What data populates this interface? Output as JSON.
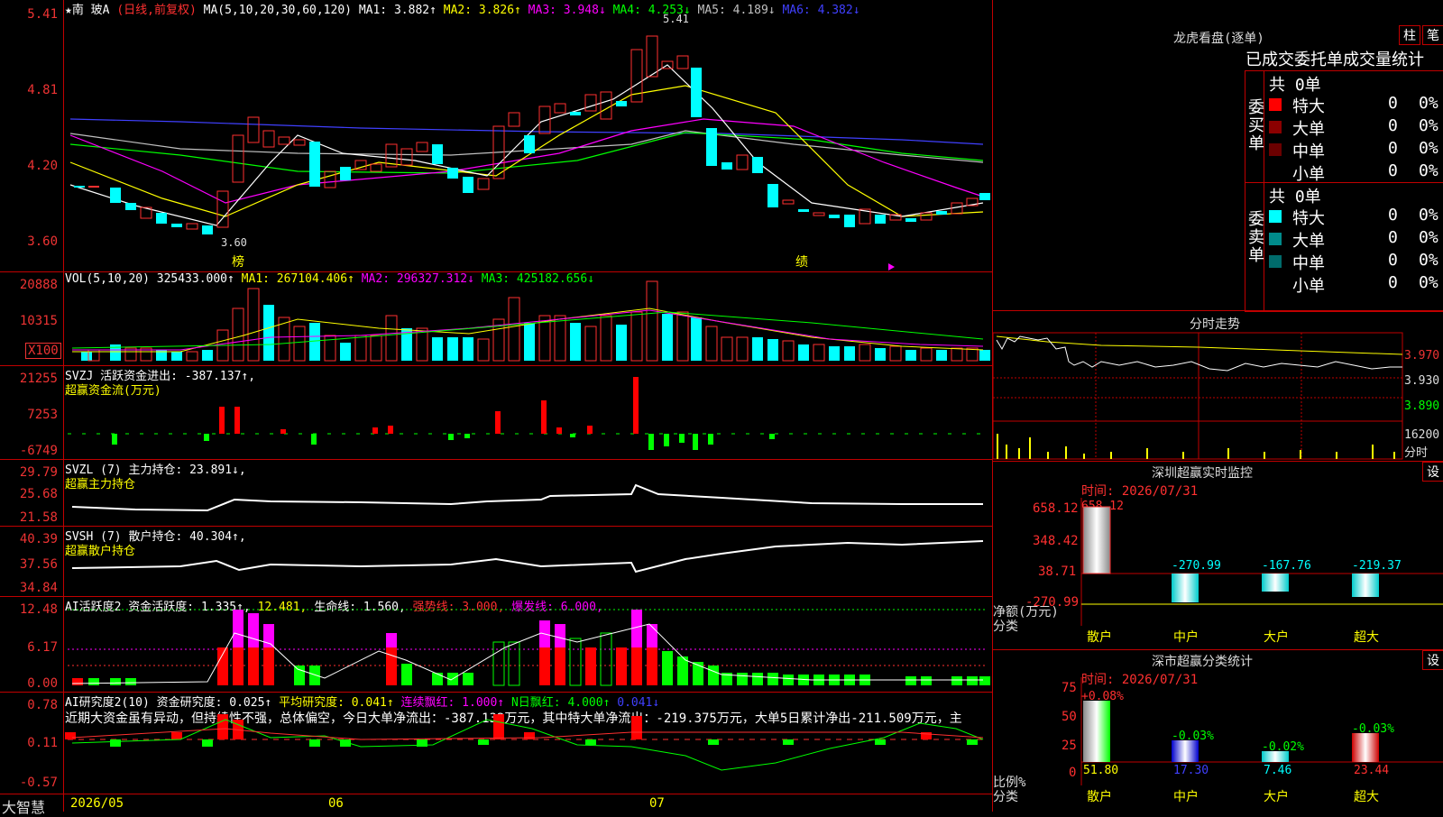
{
  "main": {
    "title": "★南  玻A",
    "period": "(日线,前复权)",
    "ma_header": "MA(5,10,20,30,60,120)",
    "ma_values": [
      {
        "label": "MA1: 3.882↑",
        "color": "#ffffff"
      },
      {
        "label": "MA2: 3.826↑",
        "color": "#ffff00"
      },
      {
        "label": "MA3: 3.948↓",
        "color": "#ff00ff"
      },
      {
        "label": "MA4: 4.253↓",
        "color": "#00ff00"
      },
      {
        "label": "MA5: 4.189↓",
        "color": "#c0c0c0"
      },
      {
        "label": "MA6: 4.382↓",
        "color": "#4040ff"
      }
    ],
    "y_ticks": [
      "5.41",
      "4.81",
      "4.20",
      "3.60"
    ],
    "high_label": "5.41",
    "low_label": "3.60",
    "marker_bang": "榜",
    "marker_ji": "绩"
  },
  "vol": {
    "header": "VOL(5,10,20)  325433.000↑",
    "ma_values": [
      {
        "label": "MA1: 267104.406↑",
        "color": "#ffffff"
      },
      {
        "label": "MA2: 296327.312↓",
        "color": "#ff00ff"
      },
      {
        "label": "MA3: 425182.656↓",
        "color": "#00ff00"
      }
    ],
    "y_ticks": [
      "20888",
      "10315"
    ],
    "unit": "X100"
  },
  "svzj": {
    "header": "SVZJ  活跃资金进出: -387.137↑,",
    "sub": "超赢资金流(万元)",
    "y_ticks": [
      "21255",
      "7253",
      "-6749"
    ]
  },
  "svzl": {
    "header": "SVZL (7) 主力持仓: 23.891↓,",
    "sub": "超赢主力持仓",
    "y_ticks": [
      "29.79",
      "25.68",
      "21.58"
    ]
  },
  "svsh": {
    "header": "SVSH (7) 散户持仓: 40.304↑,",
    "sub": "超赢散户持仓",
    "y_ticks": [
      "40.39",
      "37.56",
      "34.84"
    ]
  },
  "ai1": {
    "header": "AI活跃度2 资金活跃度: 1.335↑,",
    "v2": "12.481,",
    "v3": "生命线: 1.560,",
    "v4": "强势线: 3.000,",
    "v5": "爆发线: 6.000,",
    "y_ticks": [
      "12.48",
      "6.17",
      "0.00"
    ]
  },
  "ai2": {
    "header": "AI研究度2(10) 资金研究度: 0.025↑",
    "v2": "平均研究度: 0.041↑",
    "v3": "连续飘红: 1.000↑",
    "v4": "N日飘红: 4.000↑",
    "v5": "0.041↓",
    "text": "近期大资金虽有异动，但持续性不强，总体偏空，今日大单净流出：-387.132万元，其中特大单净流出：-219.375万元，大单5日累计净出-211.509万元，主",
    "y_ticks": [
      "0.78",
      "0.11",
      "-0.57"
    ]
  },
  "bottom": {
    "brand": "大智慧",
    "dates": [
      "2026/05",
      "06",
      "07"
    ]
  },
  "right": {
    "lhkp_title": "龙虎看盘(逐单)",
    "btn_zhu": "柱",
    "btn_bi": "笔",
    "stats_title": "已成交委托单成交量统计",
    "buy_label": "委买单",
    "sell_label": "委卖单",
    "total_label": "共 0单",
    "rows": [
      {
        "name": "特大",
        "val": "0",
        "pct": "0%"
      },
      {
        "name": "大单",
        "val": "0",
        "pct": "0%"
      },
      {
        "name": "中单",
        "val": "0",
        "pct": "0%"
      },
      {
        "name": "小单",
        "val": "0",
        "pct": "0%"
      }
    ],
    "buy_colors": [
      "#ff0000",
      "#8b0000",
      "#6b0000",
      ""
    ],
    "sell_colors": [
      "#00ffff",
      "#008b8b",
      "#006b6b",
      ""
    ],
    "fenshi_title": "分时走势",
    "fenshi_ticks": [
      "3.970",
      "3.930",
      "3.890",
      "16200",
      "分时"
    ],
    "sz_title": "深圳超赢实时监控",
    "sz_time": "时间: 2026/07/31",
    "sz_ticks": [
      "658.12",
      "348.42",
      "38.71",
      "-270.99"
    ],
    "sz_values": [
      "658.12",
      "-270.99",
      "-167.76",
      "-219.37"
    ],
    "sz_axis_label1": "净额(万元)",
    "sz_axis_label2": "分类",
    "cats": [
      "散户",
      "中户",
      "大户",
      "超大"
    ],
    "set_btn": "设",
    "ss_title": "深市超赢分类统计",
    "ss_time": "时间: 2026/07/31",
    "ss_ticks": [
      "75",
      "50",
      "25",
      "0"
    ],
    "ss_top": [
      "+0.08%",
      "-0.03%",
      "-0.02%",
      "-0.03%"
    ],
    "ss_bottom": [
      "51.80",
      "17.30",
      "7.46",
      "23.44"
    ],
    "ss_axis_label1": "比例%",
    "ss_axis_label2": "分类"
  }
}
